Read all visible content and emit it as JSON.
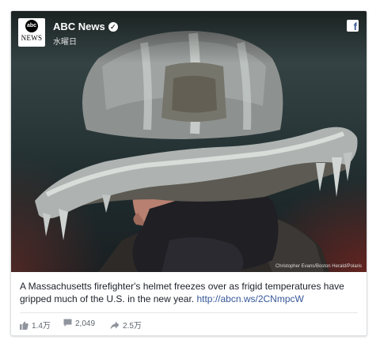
{
  "post": {
    "source": "ABC News",
    "logo_text": "abc",
    "logo_sub": "NEWS",
    "date": "水曜日",
    "photo_credit": "Christopher Evans/Boston Herald/Polaris",
    "caption": "A Massachusetts firefighter's helmet freezes over as frigid temperatures have gripped much of the U.S. in the new year.",
    "link": "http://abcn.ws/2CNmpcW",
    "likes": "1.4万",
    "comments": "2,049",
    "shares": "2.5万"
  },
  "icons": {
    "facebook": "facebook-icon",
    "verified": "verified-check-icon",
    "like": "thumbs-up-icon",
    "comment": "comment-icon",
    "share": "share-arrow-icon"
  },
  "colors": {
    "link": "#365899",
    "facebook_blue": "#3b5998"
  }
}
